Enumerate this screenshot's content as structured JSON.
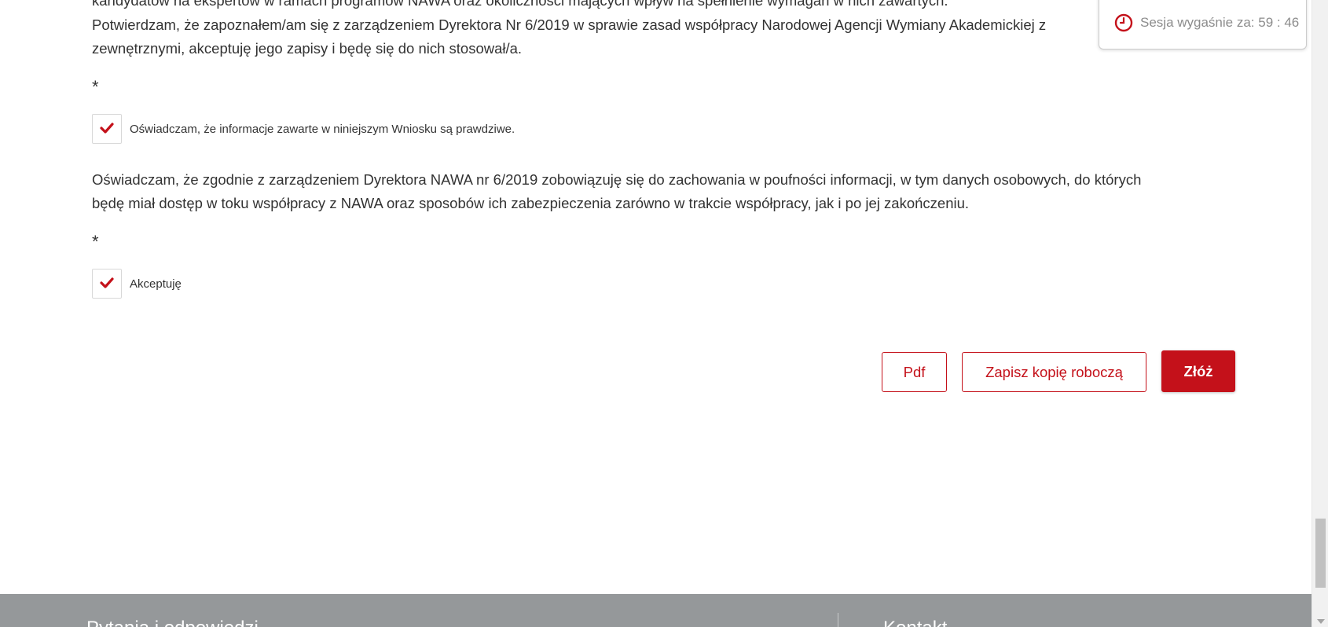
{
  "consents": {
    "line_cut_top": "kandydatów na ekspertów w ramach programów NAWA oraz okoliczności mających wpływ na spełnienie wymagań w nich zawartych.",
    "para1_line1": "Potwierdzam, że zapoznałem/am się z zarządzeniem Dyrektora Nr 6/2019 w sprawie zasad współpracy Narodowej Agencji Wymiany Akademickiej z",
    "para1_line2": "zewnętrznymi, akceptuję jego zapisy i będę się do nich stosował/a.",
    "asterisk1": "*",
    "checkbox1_label": "Oświadczam, że informacje zawarte w niniejszym Wniosku są prawdziwe.",
    "checkbox1_checked": true,
    "para2_line1": "Oświadczam, że zgodnie z zarządzeniem Dyrektora NAWA nr 6/2019 zobowiązuję się do zachowania w poufności informacji, w tym danych osobowych, do których",
    "para2_line2": "będę miał dostęp w toku współpracy z NAWA oraz sposobów ich zabezpieczenia zarówno w trakcie współpracy, jak i po jej zakończeniu.",
    "asterisk2": "*",
    "checkbox2_label": "Akceptuję",
    "checkbox2_checked": true,
    "check_icon": "checkmark-icon"
  },
  "actions": {
    "pdf_label": "Pdf",
    "save_draft_label": "Zapisz kopię roboczą",
    "submit_label": "Złóż"
  },
  "session": {
    "label": "Sesja wygaśnie za: 59 : 46",
    "icon": "clock-icon"
  },
  "footer": {
    "col1_title": "Pytania i odpowiedzi",
    "col2_title": "Kontakt"
  },
  "colors": {
    "accent": "#c4111a",
    "footer_bg": "#95989a",
    "text": "#333333"
  }
}
